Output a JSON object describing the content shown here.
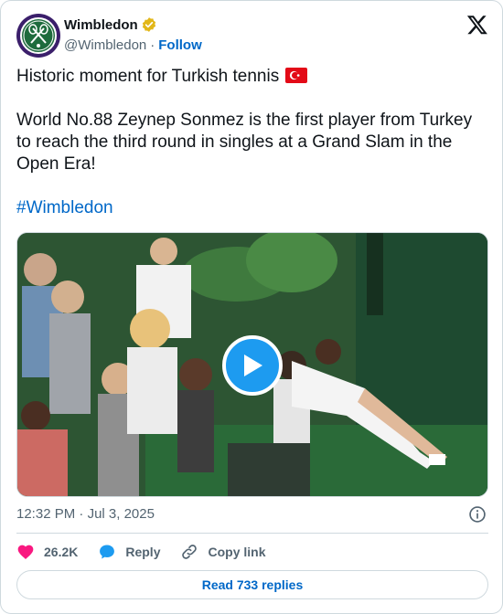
{
  "author": {
    "display_name": "Wimbledon",
    "handle": "@Wimbledon",
    "separator": "·",
    "follow_label": "Follow",
    "avatar_text": "THE CHAMPIONSHIPS WIMBLEDON",
    "verified_color": "#e2b719"
  },
  "post": {
    "line1": "Historic moment for Turkish tennis",
    "flag": "turkey-flag",
    "line2": "World No.88 Zeynep Sonmez is the first player from Turkey to reach the third round in singles at a Grand Slam in the Open Era!",
    "hashtag": "#Wimbledon"
  },
  "meta": {
    "time": "12:32 PM",
    "separator": "·",
    "date": "Jul 3, 2025"
  },
  "actions": {
    "like_count": "26.2K",
    "reply_label": "Reply",
    "copy_label": "Copy link"
  },
  "read_replies_label": "Read 733 replies",
  "colors": {
    "accent": "#1d9bf0",
    "link": "#0068c8",
    "like": "#f91880",
    "muted": "#536471",
    "border": "#cfd9de"
  }
}
